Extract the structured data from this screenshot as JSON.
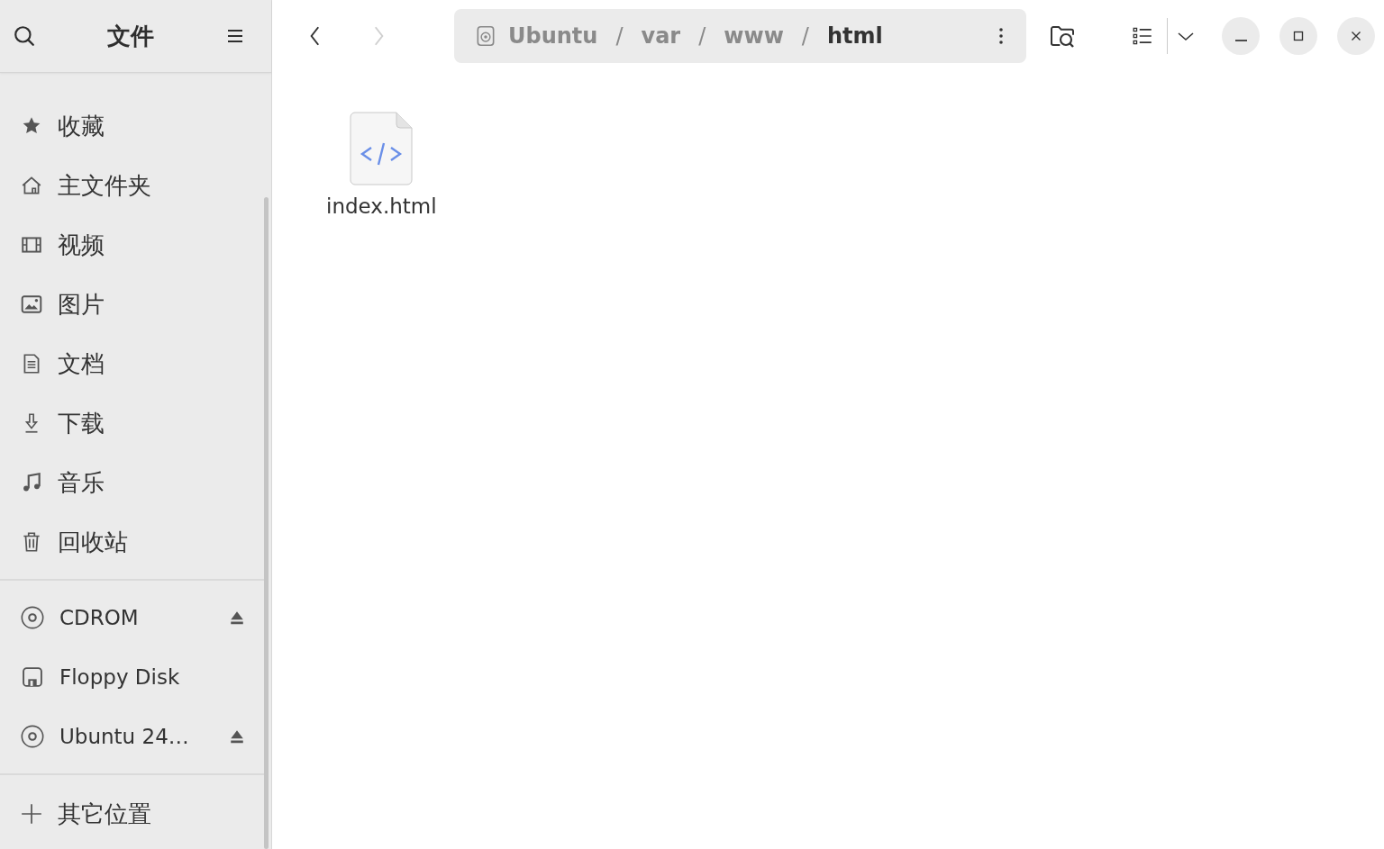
{
  "sidebar": {
    "title": "文件",
    "places": [
      {
        "kind": "star",
        "label": "收藏"
      },
      {
        "kind": "home",
        "label": "主文件夹"
      },
      {
        "kind": "video",
        "label": "视频"
      },
      {
        "kind": "picture",
        "label": "图片"
      },
      {
        "kind": "document",
        "label": "文档"
      },
      {
        "kind": "download",
        "label": "下载"
      },
      {
        "kind": "music",
        "label": "音乐"
      },
      {
        "kind": "trash",
        "label": "回收站"
      }
    ],
    "devices": [
      {
        "kind": "disc",
        "label": "CDROM",
        "ejectable": true
      },
      {
        "kind": "floppy",
        "label": "Floppy Disk",
        "ejectable": false
      },
      {
        "kind": "disc",
        "label": "Ubuntu 24…",
        "ejectable": true
      }
    ],
    "other": {
      "label": "其它位置"
    }
  },
  "toolbar": {
    "separator": "/",
    "back": {
      "disabled": false
    },
    "forward": {
      "disabled": true
    },
    "path": [
      {
        "label": "Ubuntu",
        "selected": false
      },
      {
        "label": "var",
        "selected": false
      },
      {
        "label": "www",
        "selected": false
      },
      {
        "label": "html",
        "selected": true
      }
    ]
  },
  "files": [
    {
      "name": "index.html",
      "kind": "code"
    }
  ]
}
